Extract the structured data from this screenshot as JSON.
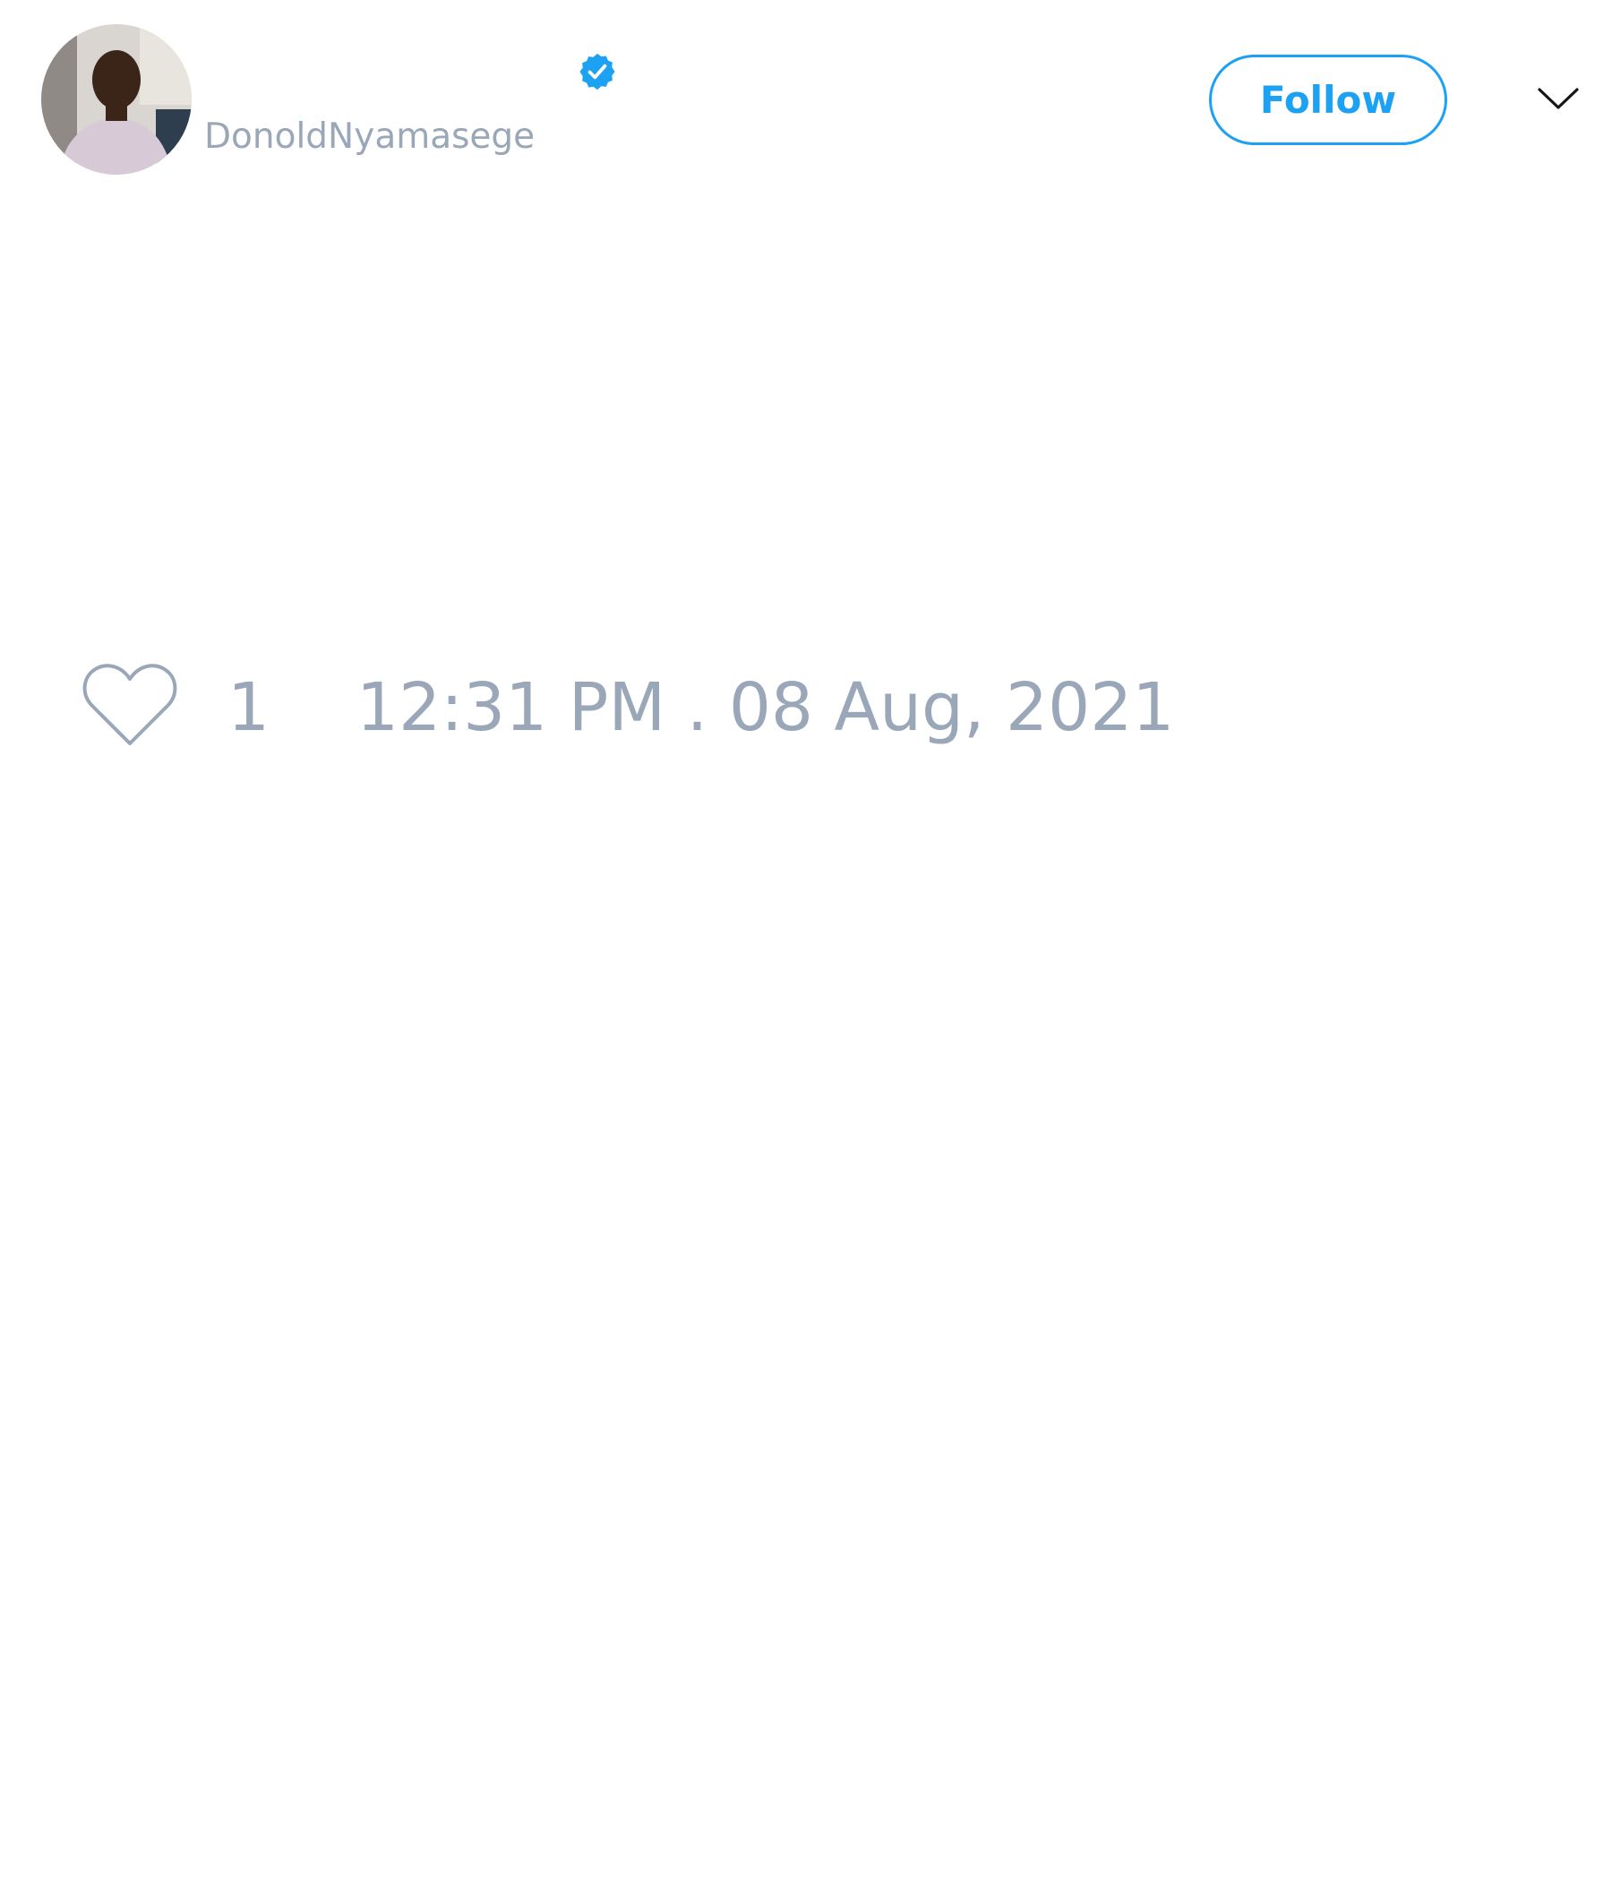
{
  "tweet": {
    "author": {
      "display_name": "",
      "handle": "DonoldNyamasege",
      "verified": true,
      "avatar_icon": "user-avatar"
    },
    "follow_button_label": "Follow",
    "menu_icon": "chevron-down-icon",
    "like_icon": "heart-outline-icon",
    "like_count": "1",
    "timestamp": "12:31 PM . 08 Aug, 2021"
  },
  "colors": {
    "accent": "#1da1f2",
    "muted_text": "#9aa7b8",
    "background": "#ffffff"
  }
}
